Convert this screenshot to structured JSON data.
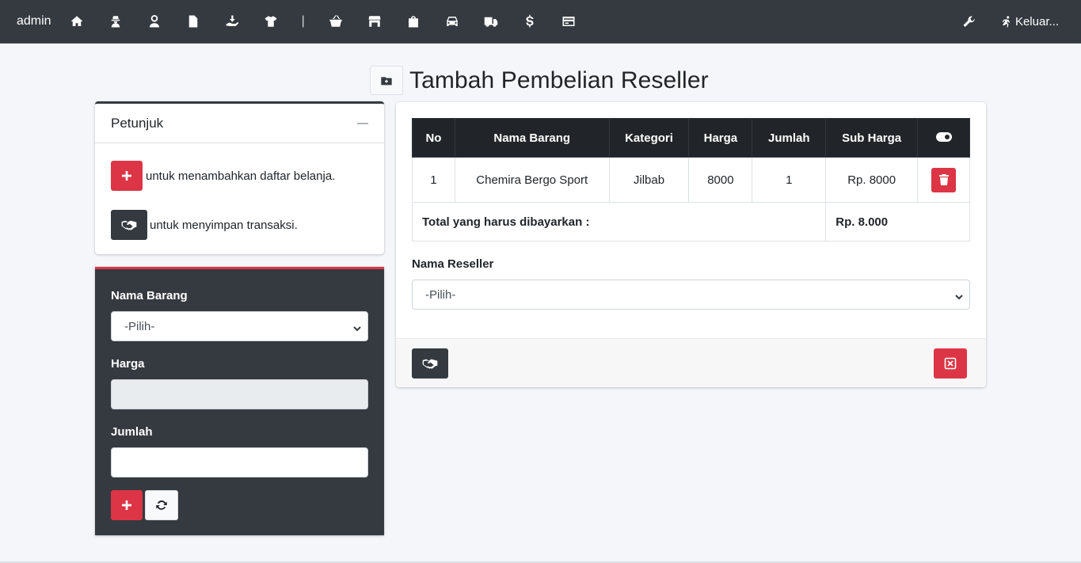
{
  "navbar": {
    "brand": "admin",
    "icons": [
      "home-icon",
      "user-secret-icon",
      "user-tie-icon",
      "file-invoice-icon",
      "hand-holding-icon",
      "tshirt-icon",
      "basket-icon",
      "store-icon",
      "shopping-bag-icon",
      "car-icon",
      "truck-icon",
      "dollar-icon",
      "credit-card-icon"
    ],
    "separator": "|",
    "logout_label": "Keluar..."
  },
  "page": {
    "title": "Tambah Pembelian Reseller"
  },
  "help": {
    "title": "Petunjuk",
    "add_text": "untuk menambahkan daftar belanja.",
    "save_text": "untuk menyimpan transaksi."
  },
  "form": {
    "item_label": "Nama Barang",
    "item_value": "-Pilih-",
    "price_label": "Harga",
    "price_value": "",
    "qty_label": "Jumlah",
    "qty_value": ""
  },
  "table": {
    "headers": [
      "No",
      "Nama Barang",
      "Kategori",
      "Harga",
      "Jumlah",
      "Sub Harga"
    ],
    "rows": [
      {
        "no": "1",
        "name": "Chemira Bergo Sport",
        "category": "Jilbab",
        "price": "8000",
        "qty": "1",
        "subtotal": "Rp. 8000"
      }
    ],
    "total_label": "Total yang harus dibayarkan :",
    "total_value": "Rp. 8.000"
  },
  "reseller": {
    "label": "Nama Reseller",
    "value": "-Pilih-"
  },
  "colors": {
    "navbar": "#343a40",
    "danger": "#dc3545",
    "dark": "#343a40",
    "background": "#f4f6f9"
  }
}
